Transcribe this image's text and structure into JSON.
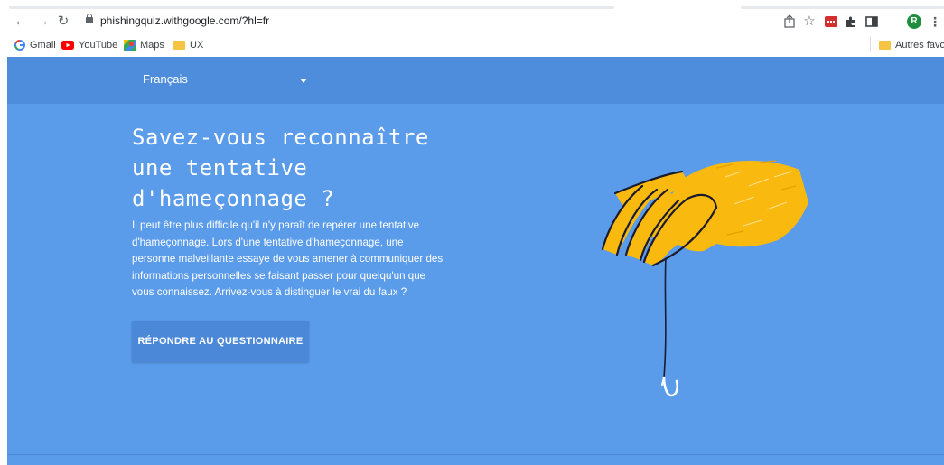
{
  "browser": {
    "url": "phishingquiz.withgoogle.com/?hl=fr",
    "profile_initial": "R",
    "bookmarks": [
      {
        "label": "Gmail",
        "icon": "google-g-icon"
      },
      {
        "label": "YouTube",
        "icon": "youtube-icon"
      },
      {
        "label": "Maps",
        "icon": "maps-icon"
      },
      {
        "label": "UX",
        "icon": "folder-icon"
      }
    ],
    "other_bookmarks": "Autres favoris"
  },
  "header": {
    "language": "Français"
  },
  "hero": {
    "title": "Savez-vous reconnaître une tentative d'hameçonnage ?",
    "description": "Il peut être plus difficile qu'il n'y paraît de repérer une tentative d'hameçonnage. Lors d'une tentative d'hameçonnage, une personne malveillante essaye de vous amener à communiquer des informations personnelles se faisant passer pour quelqu'un que vous connaissez. Arrivez-vous à distinguer le vrai du faux ?",
    "cta_label": "RÉPONDRE AU QUESTIONNAIRE"
  },
  "colors": {
    "page_background": "#5a9bea",
    "header_background": "#4d8ddc",
    "button_background": "#4b89d8",
    "hand_yellow": "#f9b90e"
  }
}
